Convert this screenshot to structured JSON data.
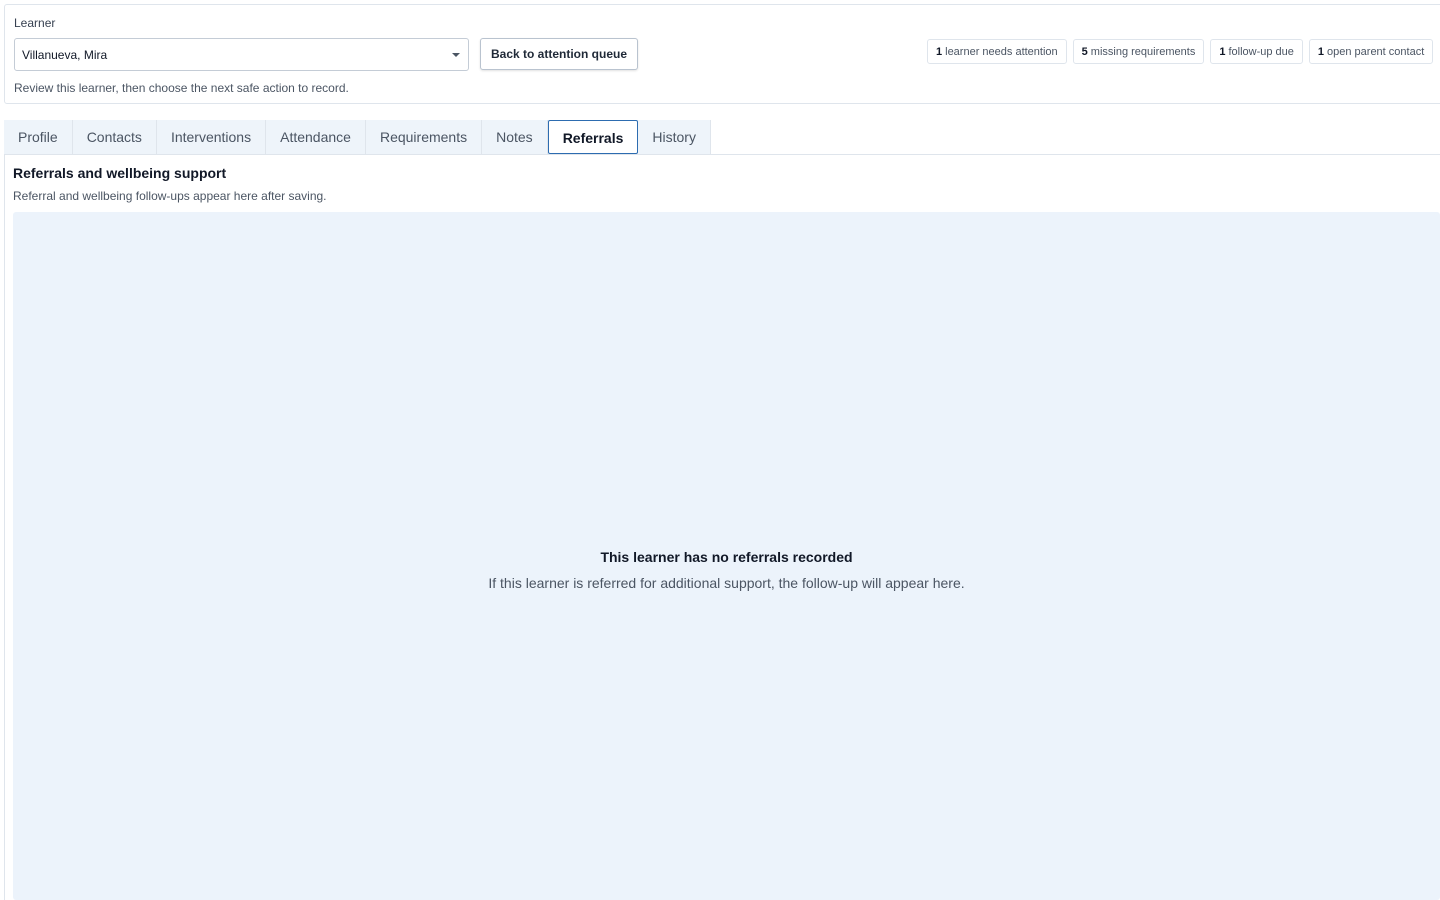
{
  "header": {
    "learner_label": "Learner",
    "learner_selected": "Villanueva, Mira",
    "back_button_label": "Back to attention queue",
    "review_text": "Review this learner, then choose the next safe action to record.",
    "badges": [
      {
        "count": "1",
        "label": "learner needs attention"
      },
      {
        "count": "5",
        "label": "missing requirements"
      },
      {
        "count": "1",
        "label": "follow-up due"
      },
      {
        "count": "1",
        "label": "open parent contact"
      }
    ]
  },
  "tabs": [
    {
      "label": "Profile",
      "active": false
    },
    {
      "label": "Contacts",
      "active": false
    },
    {
      "label": "Interventions",
      "active": false
    },
    {
      "label": "Attendance",
      "active": false
    },
    {
      "label": "Requirements",
      "active": false
    },
    {
      "label": "Notes",
      "active": false
    },
    {
      "label": "Referrals",
      "active": true
    },
    {
      "label": "History",
      "active": false
    }
  ],
  "section": {
    "title": "Referrals and wellbeing support",
    "subtitle": "Referral and wellbeing follow-ups appear here after saving."
  },
  "empty_state": {
    "title": "This learner has no referrals recorded",
    "description": "If this learner is referred for additional support, the follow-up will appear here."
  },
  "icons": {
    "dropdown": "chevron-down-icon"
  },
  "colors": {
    "accent": "#2d6cb0",
    "empty_panel_bg": "#ecf3fb",
    "tab_bg": "#eef4fa"
  }
}
